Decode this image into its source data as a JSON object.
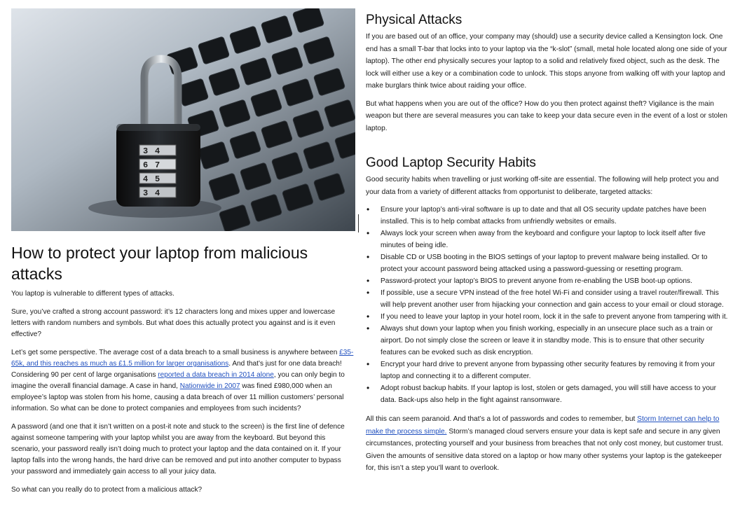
{
  "left": {
    "hero_image": {
      "alt": "Padlock on a laptop keyboard",
      "dial_digits": [
        "3",
        "4",
        "6",
        "7",
        "4",
        "5",
        "3",
        "4"
      ]
    },
    "title": "How to protect your laptop from malicious attacks",
    "p1": "You laptop is vulnerable to different types of attacks.",
    "p2": "Sure, you’ve crafted a strong account password: it’s 12 characters long and mixes upper and lowercase letters with random numbers and symbols. But what does this actually protect you against and is it even effective?",
    "p3": {
      "t1": "Let’s get some perspective. The average cost of a data breach to a small business is anywhere between ",
      "link1": "£35-65k, and this reaches as much as £1.5 million for larger organisations",
      "t2": ". And that’s just for one data breach! Considering 90 per cent of large organisations ",
      "link2": "reported a data breach in 2014 alone",
      "t3": ", you can only begin to imagine the overall financial damage. A case in hand, ",
      "link3": "Nationwide in 2007",
      "t4": " was fined £980,000 when an employee’s laptop was stolen from his home, causing a data breach of over 11 million customers’ personal information. So what can be done to protect companies and employees from such incidents?"
    },
    "p4": "A password (and one that it isn’t written on a post-it note and stuck to the screen) is the first line of defence against someone tampering with your laptop whilst you are away from the keyboard. But beyond this scenario, your password really isn’t doing much to protect your laptop and the data contained on it. If your laptop falls into the wrong hands, the hard drive can be removed and put into another computer to bypass your password and immediately gain access to all your juicy data.",
    "p5": "So what can you really do to protect from a malicious attack?"
  },
  "right": {
    "physical": {
      "heading": "Physical Attacks",
      "p1": "If you are based out of an office, your company may (should) use a security device called a Kensington lock. One end has a small T-bar that locks into to your laptop via the “k-slot” (small, metal hole located along one side of your laptop). The other end physically secures your laptop to a solid and relatively fixed object, such as the desk. The lock will either use a key or a combination code to unlock. This stops anyone from walking off with your laptop and make burglars think twice about raiding your office.",
      "p2": "But what happens when you are out of the office? How do you then protect against theft? Vigilance is the main weapon but there are several measures you can take to keep your data secure even in the event of a lost or stolen laptop."
    },
    "habits": {
      "heading": "Good Laptop Security Habits",
      "intro": "Good security habits when travelling or just working off-site are essential. The following will help protect you and your data from a variety of different attacks from opportunist to deliberate, targeted attacks:",
      "bullets": [
        "Ensure your laptop’s anti-viral software is up to date and that all OS security update patches have been installed. This is to help combat attacks from unfriendly websites or emails.",
        "Always lock your screen when away from the keyboard and configure your laptop to lock itself after five minutes of being idle.",
        "Disable CD or USB booting in the BIOS settings of your laptop to prevent malware being installed. Or to protect your account password being attacked using a password-guessing or resetting program.",
        "Password-protect your laptop’s BIOS to prevent anyone from re-enabling the USB boot-up options.",
        "If possible, use a secure VPN instead of the free hotel Wi-Fi and consider using a travel router/firewall. This will help prevent another user from hijacking your connection and gain access to your email or cloud storage.",
        "If you need to leave your laptop in your hotel room, lock it in the safe to prevent anyone from tampering with it.",
        "Always shut down your laptop when you finish working, especially in an unsecure place such as a train or airport. Do not simply close the screen or leave it in standby mode. This is to ensure that other security features can be evoked such as disk encryption.",
        "Encrypt your hard drive to prevent anyone from bypassing other security features by removing it from your laptop and connecting it to a different computer.",
        "Adopt robust backup habits. If your laptop is lost, stolen or gets damaged, you will still have access to your data. Back-ups also help in the fight against ransomware."
      ],
      "closing": {
        "t1": "All this can seem paranoid. And that’s a lot of passwords and codes to remember, but ",
        "link": "Storm Internet can help to make the process simple.",
        "t2": " Storm’s managed cloud servers ensure your data is kept safe and secure in any given circumstances, protecting yourself and your business from breaches that not only cost money, but customer trust. Given the amounts of sensitive data stored on a laptop or how many other systems your laptop is the gatekeeper for, this isn’t a step you’ll want to overlook."
      }
    }
  }
}
